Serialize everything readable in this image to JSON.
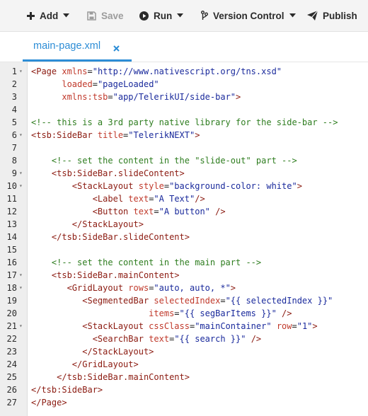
{
  "toolbar": {
    "add_label": "Add",
    "save_label": "Save",
    "run_label": "Run",
    "version_control_label": "Version Control",
    "publish_label": "Publish"
  },
  "tab": {
    "label": "main-page.xml"
  },
  "code_lines": [
    {
      "num": "1",
      "fold": true,
      "tokens": [
        [
          "tag",
          "<Page "
        ],
        [
          "attr",
          "xmlns"
        ],
        [
          "plain",
          "="
        ],
        [
          "str",
          "\"http://www.nativescript.org/tns.xsd\""
        ]
      ]
    },
    {
      "num": "2",
      "fold": false,
      "tokens": [
        [
          "plain",
          "      "
        ],
        [
          "attr",
          "loaded"
        ],
        [
          "plain",
          "="
        ],
        [
          "str",
          "\"pageLoaded\""
        ]
      ]
    },
    {
      "num": "3",
      "fold": false,
      "tokens": [
        [
          "plain",
          "      "
        ],
        [
          "attr",
          "xmlns:tsb"
        ],
        [
          "plain",
          "="
        ],
        [
          "str",
          "\"app/TelerikUI/side-bar\""
        ],
        [
          "tag",
          ">"
        ]
      ]
    },
    {
      "num": "4",
      "fold": false,
      "tokens": []
    },
    {
      "num": "5",
      "fold": false,
      "tokens": [
        [
          "comment",
          "<!-- this is a 3rd party native library for the side-bar -->"
        ]
      ]
    },
    {
      "num": "6",
      "fold": true,
      "tokens": [
        [
          "tag",
          "<tsb:SideBar "
        ],
        [
          "attr",
          "title"
        ],
        [
          "plain",
          "="
        ],
        [
          "str",
          "\"TelerikNEXT\""
        ],
        [
          "tag",
          ">"
        ]
      ]
    },
    {
      "num": "7",
      "fold": false,
      "tokens": []
    },
    {
      "num": "8",
      "fold": false,
      "tokens": [
        [
          "plain",
          "    "
        ],
        [
          "comment",
          "<!-- set the content in the \"slide-out\" part -->"
        ]
      ]
    },
    {
      "num": "9",
      "fold": true,
      "tokens": [
        [
          "plain",
          "    "
        ],
        [
          "tag",
          "<tsb:SideBar.slideContent>"
        ]
      ]
    },
    {
      "num": "10",
      "fold": true,
      "tokens": [
        [
          "plain",
          "        "
        ],
        [
          "tag",
          "<StackLayout "
        ],
        [
          "attr",
          "style"
        ],
        [
          "plain",
          "="
        ],
        [
          "str",
          "\"background-color: white\""
        ],
        [
          "tag",
          ">"
        ]
      ]
    },
    {
      "num": "11",
      "fold": false,
      "tokens": [
        [
          "plain",
          "            "
        ],
        [
          "tag",
          "<Label "
        ],
        [
          "attr",
          "text"
        ],
        [
          "plain",
          "="
        ],
        [
          "str",
          "\"A Text\""
        ],
        [
          "tag",
          "/>"
        ]
      ]
    },
    {
      "num": "12",
      "fold": false,
      "tokens": [
        [
          "plain",
          "            "
        ],
        [
          "tag",
          "<Button "
        ],
        [
          "attr",
          "text"
        ],
        [
          "plain",
          "="
        ],
        [
          "str",
          "\"A button\""
        ],
        [
          "tag",
          " />"
        ]
      ]
    },
    {
      "num": "13",
      "fold": false,
      "tokens": [
        [
          "plain",
          "        "
        ],
        [
          "tag",
          "</StackLayout>"
        ]
      ]
    },
    {
      "num": "14",
      "fold": false,
      "tokens": [
        [
          "plain",
          "    "
        ],
        [
          "tag",
          "</tsb:SideBar.slideContent>"
        ]
      ]
    },
    {
      "num": "15",
      "fold": false,
      "tokens": []
    },
    {
      "num": "16",
      "fold": false,
      "tokens": [
        [
          "plain",
          "    "
        ],
        [
          "comment",
          "<!-- set the content in the main part -->"
        ]
      ]
    },
    {
      "num": "17",
      "fold": true,
      "tokens": [
        [
          "plain",
          "    "
        ],
        [
          "tag",
          "<tsb:SideBar.mainContent>"
        ]
      ]
    },
    {
      "num": "18",
      "fold": true,
      "tokens": [
        [
          "plain",
          "       "
        ],
        [
          "tag",
          "<GridLayout "
        ],
        [
          "attr",
          "rows"
        ],
        [
          "plain",
          "="
        ],
        [
          "str",
          "\"auto, auto, *\""
        ],
        [
          "tag",
          ">"
        ]
      ]
    },
    {
      "num": "19",
      "fold": false,
      "tokens": [
        [
          "plain",
          "          "
        ],
        [
          "tag",
          "<SegmentedBar "
        ],
        [
          "attr",
          "selectedIndex"
        ],
        [
          "plain",
          "="
        ],
        [
          "str",
          "\"{{ selectedIndex }}\""
        ]
      ]
    },
    {
      "num": "20",
      "fold": false,
      "tokens": [
        [
          "plain",
          "                       "
        ],
        [
          "attr",
          "items"
        ],
        [
          "plain",
          "="
        ],
        [
          "str",
          "\"{{ segBarItems }}\""
        ],
        [
          "tag",
          " />"
        ]
      ]
    },
    {
      "num": "21",
      "fold": true,
      "tokens": [
        [
          "plain",
          "          "
        ],
        [
          "tag",
          "<StackLayout "
        ],
        [
          "attr",
          "cssClass"
        ],
        [
          "plain",
          "="
        ],
        [
          "str",
          "\"mainContainer\""
        ],
        [
          "plain",
          " "
        ],
        [
          "attr",
          "row"
        ],
        [
          "plain",
          "="
        ],
        [
          "str",
          "\"1\""
        ],
        [
          "tag",
          ">"
        ]
      ]
    },
    {
      "num": "22",
      "fold": false,
      "tokens": [
        [
          "plain",
          "            "
        ],
        [
          "tag",
          "<SearchBar "
        ],
        [
          "attr",
          "text"
        ],
        [
          "plain",
          "="
        ],
        [
          "str",
          "\"{{ search }}\""
        ],
        [
          "tag",
          " />"
        ]
      ]
    },
    {
      "num": "23",
      "fold": false,
      "tokens": [
        [
          "plain",
          "          "
        ],
        [
          "tag",
          "</StackLayout>"
        ]
      ]
    },
    {
      "num": "24",
      "fold": false,
      "tokens": [
        [
          "plain",
          "        "
        ],
        [
          "tag",
          "</GridLayout>"
        ]
      ]
    },
    {
      "num": "25",
      "fold": false,
      "tokens": [
        [
          "plain",
          "     "
        ],
        [
          "tag",
          "</tsb:SideBar.mainContent>"
        ]
      ]
    },
    {
      "num": "26",
      "fold": false,
      "tokens": [
        [
          "tag",
          "</tsb:SideBar>"
        ]
      ]
    },
    {
      "num": "27",
      "fold": false,
      "tokens": [
        [
          "tag",
          "</Page>"
        ]
      ]
    }
  ],
  "colors": {
    "tab_accent": "#2d8dd6",
    "tag": "#8b1a10",
    "attribute": "#c0392b",
    "string": "#1a2a9c",
    "comment": "#2e7d1f"
  },
  "icons": {
    "add": "plus-icon",
    "save": "floppy-disk-icon",
    "run": "play-circle-icon",
    "version_control": "branch-icon",
    "publish": "paper-plane-icon",
    "close": "close-icon",
    "fold": "fold-arrow-icon"
  }
}
